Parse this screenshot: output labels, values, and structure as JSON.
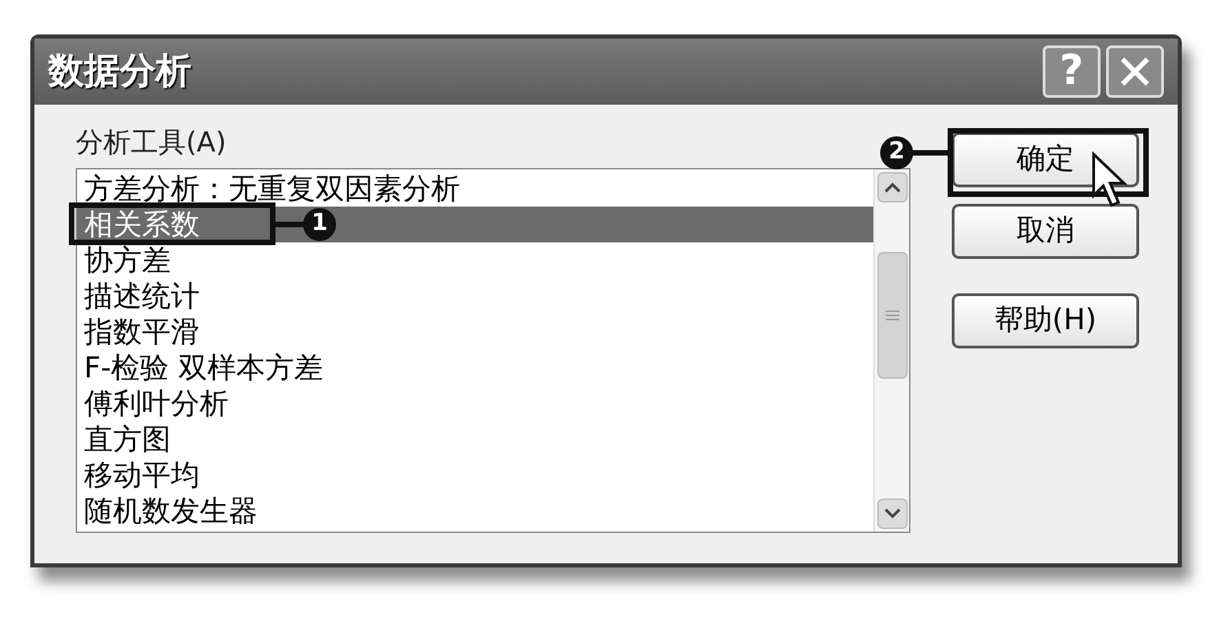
{
  "window": {
    "title": "数据分析",
    "title_buttons": [
      {
        "kind": "help",
        "label": "?"
      },
      {
        "kind": "close"
      }
    ]
  },
  "list_label": "分析工具(A)",
  "tools": [
    {
      "label": "方差分析：无重复双因素分析",
      "selected": false
    },
    {
      "label": "相关系数",
      "selected": true
    },
    {
      "label": "协方差",
      "selected": false
    },
    {
      "label": "描述统计",
      "selected": false
    },
    {
      "label": "指数平滑",
      "selected": false
    },
    {
      "label": "F-检验 双样本方差",
      "selected": false
    },
    {
      "label": "傅利叶分析",
      "selected": false
    },
    {
      "label": "直方图",
      "selected": false
    },
    {
      "label": "移动平均",
      "selected": false
    },
    {
      "label": "随机数发生器",
      "selected": false
    }
  ],
  "buttons": [
    {
      "label": "确定"
    },
    {
      "label": "取消"
    },
    {
      "label": "帮助(H)"
    }
  ],
  "callouts": [
    {
      "number": "1"
    },
    {
      "number": "2"
    }
  ]
}
